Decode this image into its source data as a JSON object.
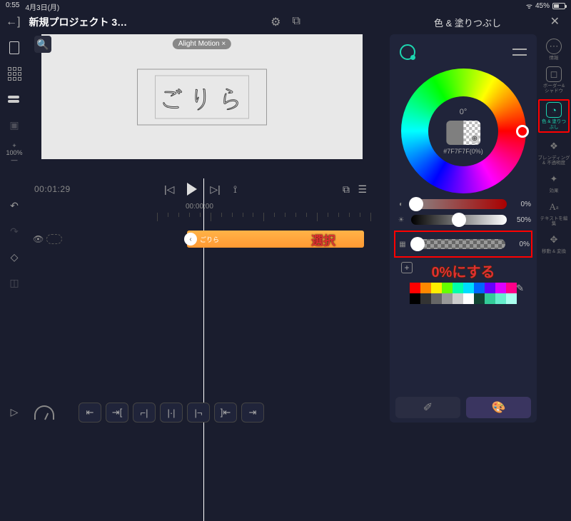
{
  "status": {
    "time": "0:55",
    "date": "4月3日(月)",
    "wifi": "●",
    "battery_pct": "45%"
  },
  "header": {
    "project_title": "新規プロジェクト 3…",
    "panel_title": "色 & 塗りつぶし"
  },
  "canvas": {
    "watermark": "Alight Motion ×",
    "text": "ごりら"
  },
  "left_toolbar": {
    "zoom": "+\n100%\n—"
  },
  "timeline": {
    "timecode": "00:01:29",
    "ruler_time": "00:00:00",
    "clip_label": "ごりら",
    "annotation_select": "選択"
  },
  "color": {
    "hue": "0°",
    "hex": "#7F7F7F(0%)",
    "sliders": {
      "s": "0%",
      "l": "50%",
      "a": "0%"
    },
    "annotation_alpha": "0%にする"
  },
  "swatches_row1": [
    "#ff0000",
    "#ff8800",
    "#ffee00",
    "#66ff00",
    "#00ffaa",
    "#00ddff",
    "#0066ff",
    "#6600ff",
    "#dd00ff",
    "#ff0088"
  ],
  "swatches_row2": [
    "#000000",
    "#333333",
    "#666666",
    "#999999",
    "#cccccc",
    "#ffffff",
    "#114433",
    "#33cc99",
    "#66eecc",
    "#aaffee"
  ],
  "right_sidebar": {
    "items": [
      {
        "label": "情報"
      },
      {
        "label": "ボーダー&\nシャドウ"
      },
      {
        "label": "色 & 塗りつぶし"
      },
      {
        "label": "ブレンディング\n& 不透明度"
      },
      {
        "label": "効果"
      },
      {
        "label": "テキストを編集"
      },
      {
        "label": "移動 & 変換"
      }
    ]
  }
}
